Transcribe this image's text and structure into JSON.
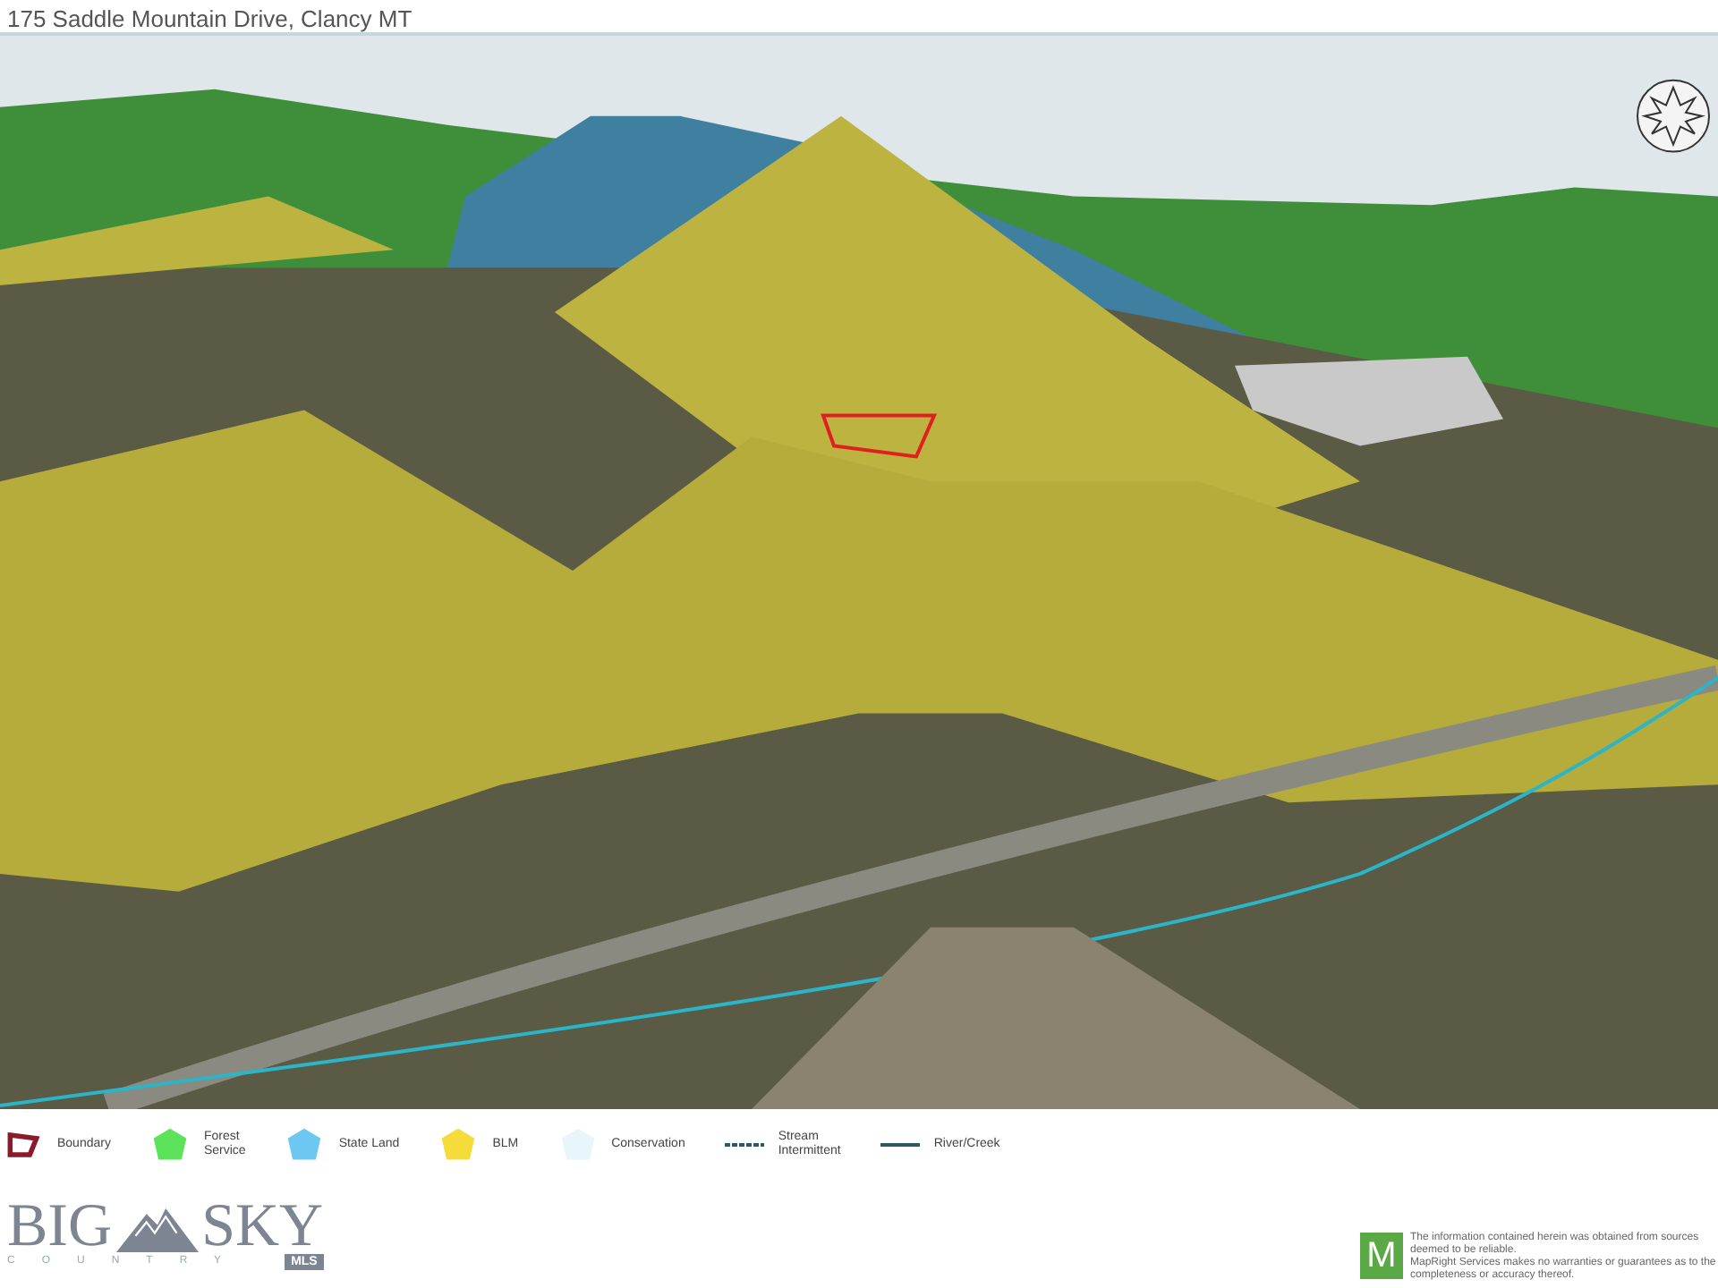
{
  "header": {
    "address": "175 Saddle Mountain Drive, Clancy MT"
  },
  "legend": [
    {
      "label": "Boundary",
      "kind": "outline",
      "color": "#8b1a2a"
    },
    {
      "label": "Forest\nService",
      "kind": "polygon",
      "color": "#5de35a"
    },
    {
      "label": "State Land",
      "kind": "polygon",
      "color": "#6cc8f0"
    },
    {
      "label": "BLM",
      "kind": "polygon",
      "color": "#f5dc3a"
    },
    {
      "label": "Conservation",
      "kind": "polygon",
      "color": "#e8f6fb"
    },
    {
      "label": "Stream\nIntermittent",
      "kind": "dashed",
      "color": "#2f5a63"
    },
    {
      "label": "River/Creek",
      "kind": "line",
      "color": "#2f5a63"
    }
  ],
  "logo": {
    "left": "BIG",
    "right": "SKY",
    "sub": "COUNTRY",
    "badge": "MLS"
  },
  "disclaimer": {
    "mark": "M",
    "lines": [
      "The information contained herein was obtained from sources deemed to be reliable.",
      "MapRight Services makes no warranties or guarantees as to the completeness or accuracy thereof."
    ]
  }
}
